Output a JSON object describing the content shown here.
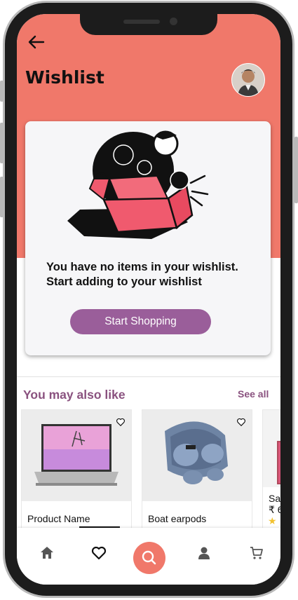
{
  "header": {
    "title": "Wishlist"
  },
  "empty_state": {
    "line1": "You have no items in your wishlist.",
    "line2": "Start adding to your wishlist",
    "button_label": "Start Shopping"
  },
  "recommendations": {
    "title": "You may also like",
    "see_all_label": "See all",
    "products": [
      {
        "name": "Product Name"
      },
      {
        "name": "Boat earpods"
      },
      {
        "name": "Sa",
        "price": "₹ 6"
      }
    ]
  },
  "bottom_nav": {
    "items": [
      "home-icon",
      "heart-icon",
      "search-icon",
      "user-icon",
      "cart-icon"
    ]
  },
  "colors": {
    "header": "#f0786a",
    "accent": "#9a5e9a",
    "section_title": "#8a527f"
  }
}
